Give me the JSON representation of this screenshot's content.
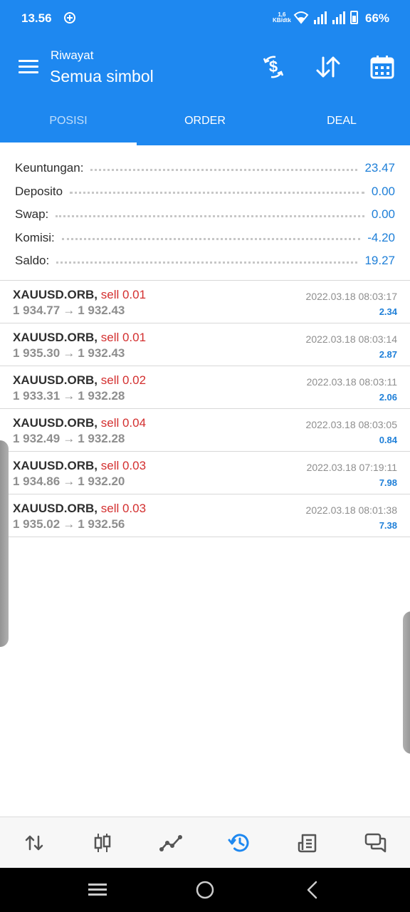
{
  "status_bar": {
    "time": "13.56",
    "speed_value": "1,6",
    "speed_unit": "KB/dtk",
    "battery": "66%"
  },
  "app_bar": {
    "subtitle": "Riwayat",
    "title": "Semua simbol",
    "icons": [
      "menu-icon",
      "dollar-exchange-icon",
      "sort-arrows-icon",
      "calendar-icon"
    ]
  },
  "tabs": [
    {
      "label": "POSISI",
      "selected": true
    },
    {
      "label": "ORDER",
      "selected": false
    },
    {
      "label": "DEAL",
      "selected": false
    }
  ],
  "summary": [
    {
      "label": "Keuntungan:",
      "value": "23.47"
    },
    {
      "label": "Deposito",
      "value": "0.00"
    },
    {
      "label": "Swap:",
      "value": "0.00"
    },
    {
      "label": "Komisi:",
      "value": "-4.20"
    },
    {
      "label": "Saldo:",
      "value": "19.27"
    }
  ],
  "deals": [
    {
      "symbol": "XAUUSD.ORB,",
      "side": "sell 0.01",
      "open": "1 934.77",
      "arrow": "→",
      "close": "1 932.43",
      "time": "2022.03.18 08:03:17",
      "profit": "2.34"
    },
    {
      "symbol": "XAUUSD.ORB,",
      "side": "sell 0.01",
      "open": "1 935.30",
      "arrow": "→",
      "close": "1 932.43",
      "time": "2022.03.18 08:03:14",
      "profit": "2.87"
    },
    {
      "symbol": "XAUUSD.ORB,",
      "side": "sell 0.02",
      "open": "1 933.31",
      "arrow": "→",
      "close": "1 932.28",
      "time": "2022.03.18 08:03:11",
      "profit": "2.06"
    },
    {
      "symbol": "XAUUSD.ORB,",
      "side": "sell 0.04",
      "open": "1 932.49",
      "arrow": "→",
      "close": "1 932.28",
      "time": "2022.03.18 08:03:05",
      "profit": "0.84"
    },
    {
      "symbol": "XAUUSD.ORB,",
      "side": "sell 0.03",
      "open": "1 934.86",
      "arrow": "→",
      "close": "1 932.20",
      "time": "2022.03.18 07:19:11",
      "profit": "7.98"
    },
    {
      "symbol": "XAUUSD.ORB,",
      "side": "sell 0.03",
      "open": "1 935.02",
      "arrow": "→",
      "close": "1 932.56",
      "time": "2022.03.18 08:01:38",
      "profit": "7.38"
    }
  ],
  "bottom_nav": [
    {
      "icon": "quotes-arrows-icon",
      "active": false
    },
    {
      "icon": "candlestick-chart-icon",
      "active": false
    },
    {
      "icon": "trade-line-icon",
      "active": false
    },
    {
      "icon": "history-icon",
      "active": true
    },
    {
      "icon": "journal-icon",
      "active": false
    },
    {
      "icon": "chat-icon",
      "active": false
    }
  ],
  "colors": {
    "accent": "#1E88F0",
    "value_blue": "#1E7FD8",
    "sell_red": "#D32F2F",
    "muted_text": "#8E8E8E"
  }
}
